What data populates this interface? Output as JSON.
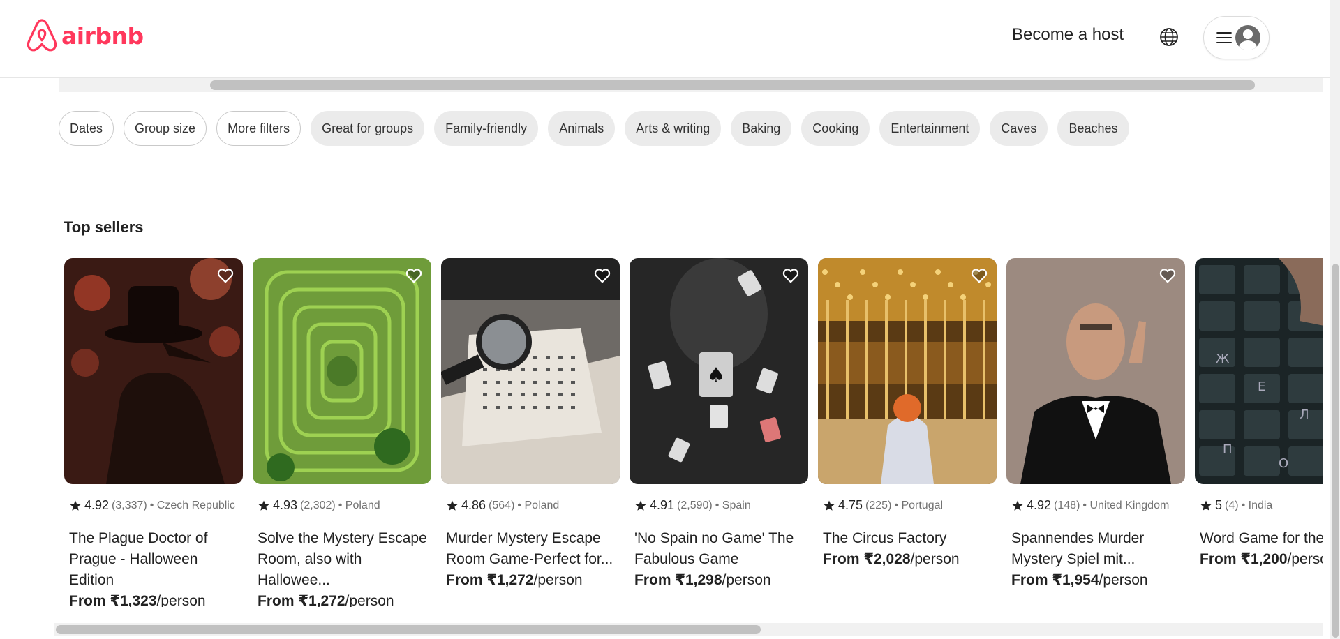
{
  "brand": {
    "name": "airbnb",
    "color": "#ff385c"
  },
  "header": {
    "host_label": "Become a host",
    "globe_icon": "globe-icon",
    "menu_icon": "hamburger-icon",
    "avatar_icon": "user-avatar-icon"
  },
  "filters": [
    {
      "label": "Dates",
      "style": "outlined"
    },
    {
      "label": "Group size",
      "style": "outlined"
    },
    {
      "label": "More filters",
      "style": "outlined"
    },
    {
      "label": "Great for groups",
      "style": "filled"
    },
    {
      "label": "Family-friendly",
      "style": "filled"
    },
    {
      "label": "Animals",
      "style": "filled"
    },
    {
      "label": "Arts & writing",
      "style": "filled"
    },
    {
      "label": "Baking",
      "style": "filled"
    },
    {
      "label": "Cooking",
      "style": "filled"
    },
    {
      "label": "Entertainment",
      "style": "filled"
    },
    {
      "label": "Caves",
      "style": "filled"
    },
    {
      "label": "Beaches",
      "style": "filled"
    }
  ],
  "section": {
    "title": "Top sellers"
  },
  "listings": [
    {
      "rating": "4.92",
      "reviews": "(3,337)",
      "country": "• Czech Republic",
      "title": "The Plague Doctor of Prague - Halloween Edition",
      "price_prefix": "From",
      "price": "₹1,323",
      "price_suffix": "/person",
      "theme": "plague"
    },
    {
      "rating": "4.93",
      "reviews": "(2,302)",
      "country": "• Poland",
      "title": "Solve the Mystery Escape Room, also with Hallowee...",
      "price_prefix": "From",
      "price": "₹1,272",
      "price_suffix": "/person",
      "theme": "maze"
    },
    {
      "rating": "4.86",
      "reviews": "(564)",
      "country": "• Poland",
      "title": "Murder Mystery Escape Room Game-Perfect for...",
      "price_prefix": "From",
      "price": "₹1,272",
      "price_suffix": "/person",
      "theme": "magnifier"
    },
    {
      "rating": "4.91",
      "reviews": "(2,590)",
      "country": "• Spain",
      "title": "'No Spain no Game' The Fabulous Game",
      "price_prefix": "From",
      "price": "₹1,298",
      "price_suffix": "/person",
      "theme": "cards"
    },
    {
      "rating": "4.75",
      "reviews": "(225)",
      "country": "• Portugal",
      "title": "The Circus Factory",
      "price_prefix": "From",
      "price": "₹2,028",
      "price_suffix": "/person",
      "theme": "circus"
    },
    {
      "rating": "4.92",
      "reviews": "(148)",
      "country": "• United Kingdom",
      "title": "Spannendes Murder Mystery Spiel mit...",
      "price_prefix": "From",
      "price": "₹1,954",
      "price_suffix": "/person",
      "theme": "tuxedo"
    },
    {
      "rating": "5",
      "reviews": "(4)",
      "country": "• India",
      "title": "Word Game for the nerds",
      "price_prefix": "From",
      "price": "₹1,200",
      "price_suffix": "/person",
      "theme": "keys"
    }
  ]
}
